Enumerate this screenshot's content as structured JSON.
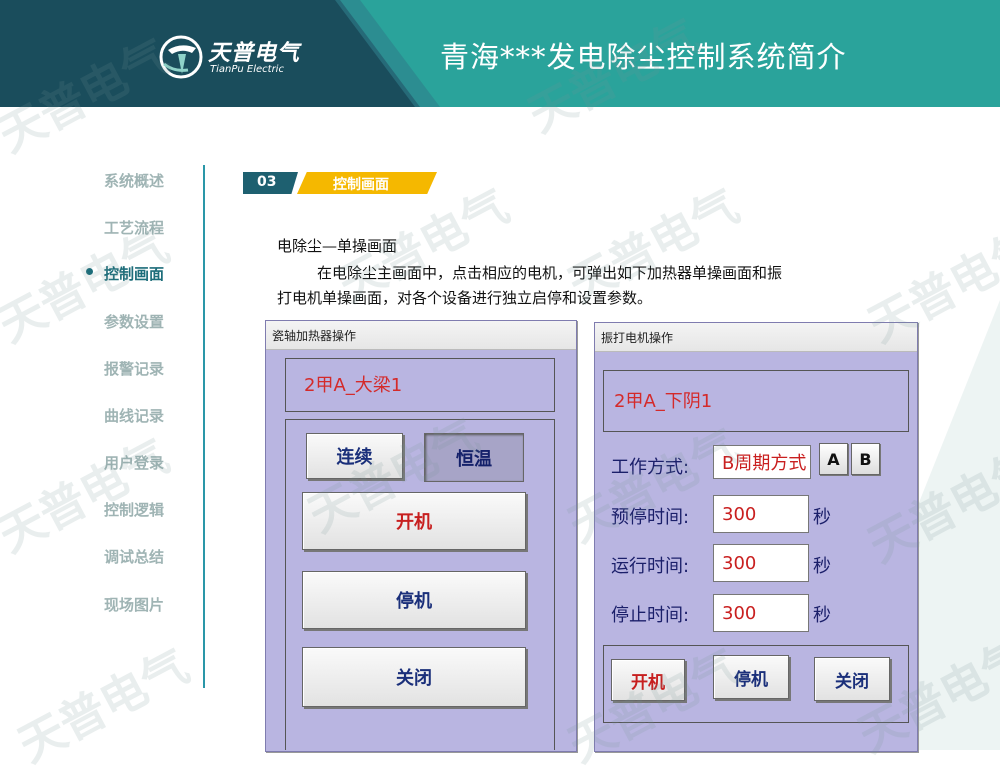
{
  "header": {
    "logo_brand": "天普电气",
    "logo_sub": "TianPu Electric",
    "title": "青海***发电除尘控制系统简介",
    "colors": {
      "dark": "#1a4d5c",
      "teal": "#2aa39b"
    }
  },
  "sidebar": {
    "items": [
      {
        "label": "系统概述",
        "active": false
      },
      {
        "label": "工艺流程",
        "active": false
      },
      {
        "label": "控制画面",
        "active": true
      },
      {
        "label": "参数设置",
        "active": false
      },
      {
        "label": "报警记录",
        "active": false
      },
      {
        "label": "曲线记录",
        "active": false
      },
      {
        "label": "用户登录",
        "active": false
      },
      {
        "label": "控制逻辑",
        "active": false
      },
      {
        "label": "调试总结",
        "active": false
      },
      {
        "label": "现场图片",
        "active": false
      }
    ]
  },
  "section": {
    "number": "03",
    "label": "控制画面",
    "colors": {
      "num_bg": "#1e6070",
      "label_bg": "#f5b800"
    }
  },
  "content": {
    "subheading": "电除尘—单操画面",
    "desc_line1": "在电除尘主画面中，点击相应的电机，可弹出如下加热器单操画面和振",
    "desc_line2": "打电机单操画面，对各个设备进行独立启停和设置参数。"
  },
  "heater_window": {
    "title": "瓷轴加热器操作",
    "device_name": "2甲A_大梁1",
    "mode_continuous": "连续",
    "mode_constant_temp": "恒温",
    "start": "开机",
    "stop": "停机",
    "close": "关闭"
  },
  "rapper_window": {
    "title": "振打电机操作",
    "device_name": "2甲A_下阴1",
    "work_mode_label": "工作方式:",
    "work_mode_value": "B周期方式",
    "mode_a": "A",
    "mode_b": "B",
    "pre_stop_label": "预停时间:",
    "pre_stop_value": "300",
    "run_label": "运行时间:",
    "run_value": "300",
    "stop_label": "停止时间:",
    "stop_value": "300",
    "unit": "秒",
    "start": "开机",
    "stop": "停机",
    "close": "关闭"
  },
  "watermark": {
    "text": "天普电气"
  }
}
